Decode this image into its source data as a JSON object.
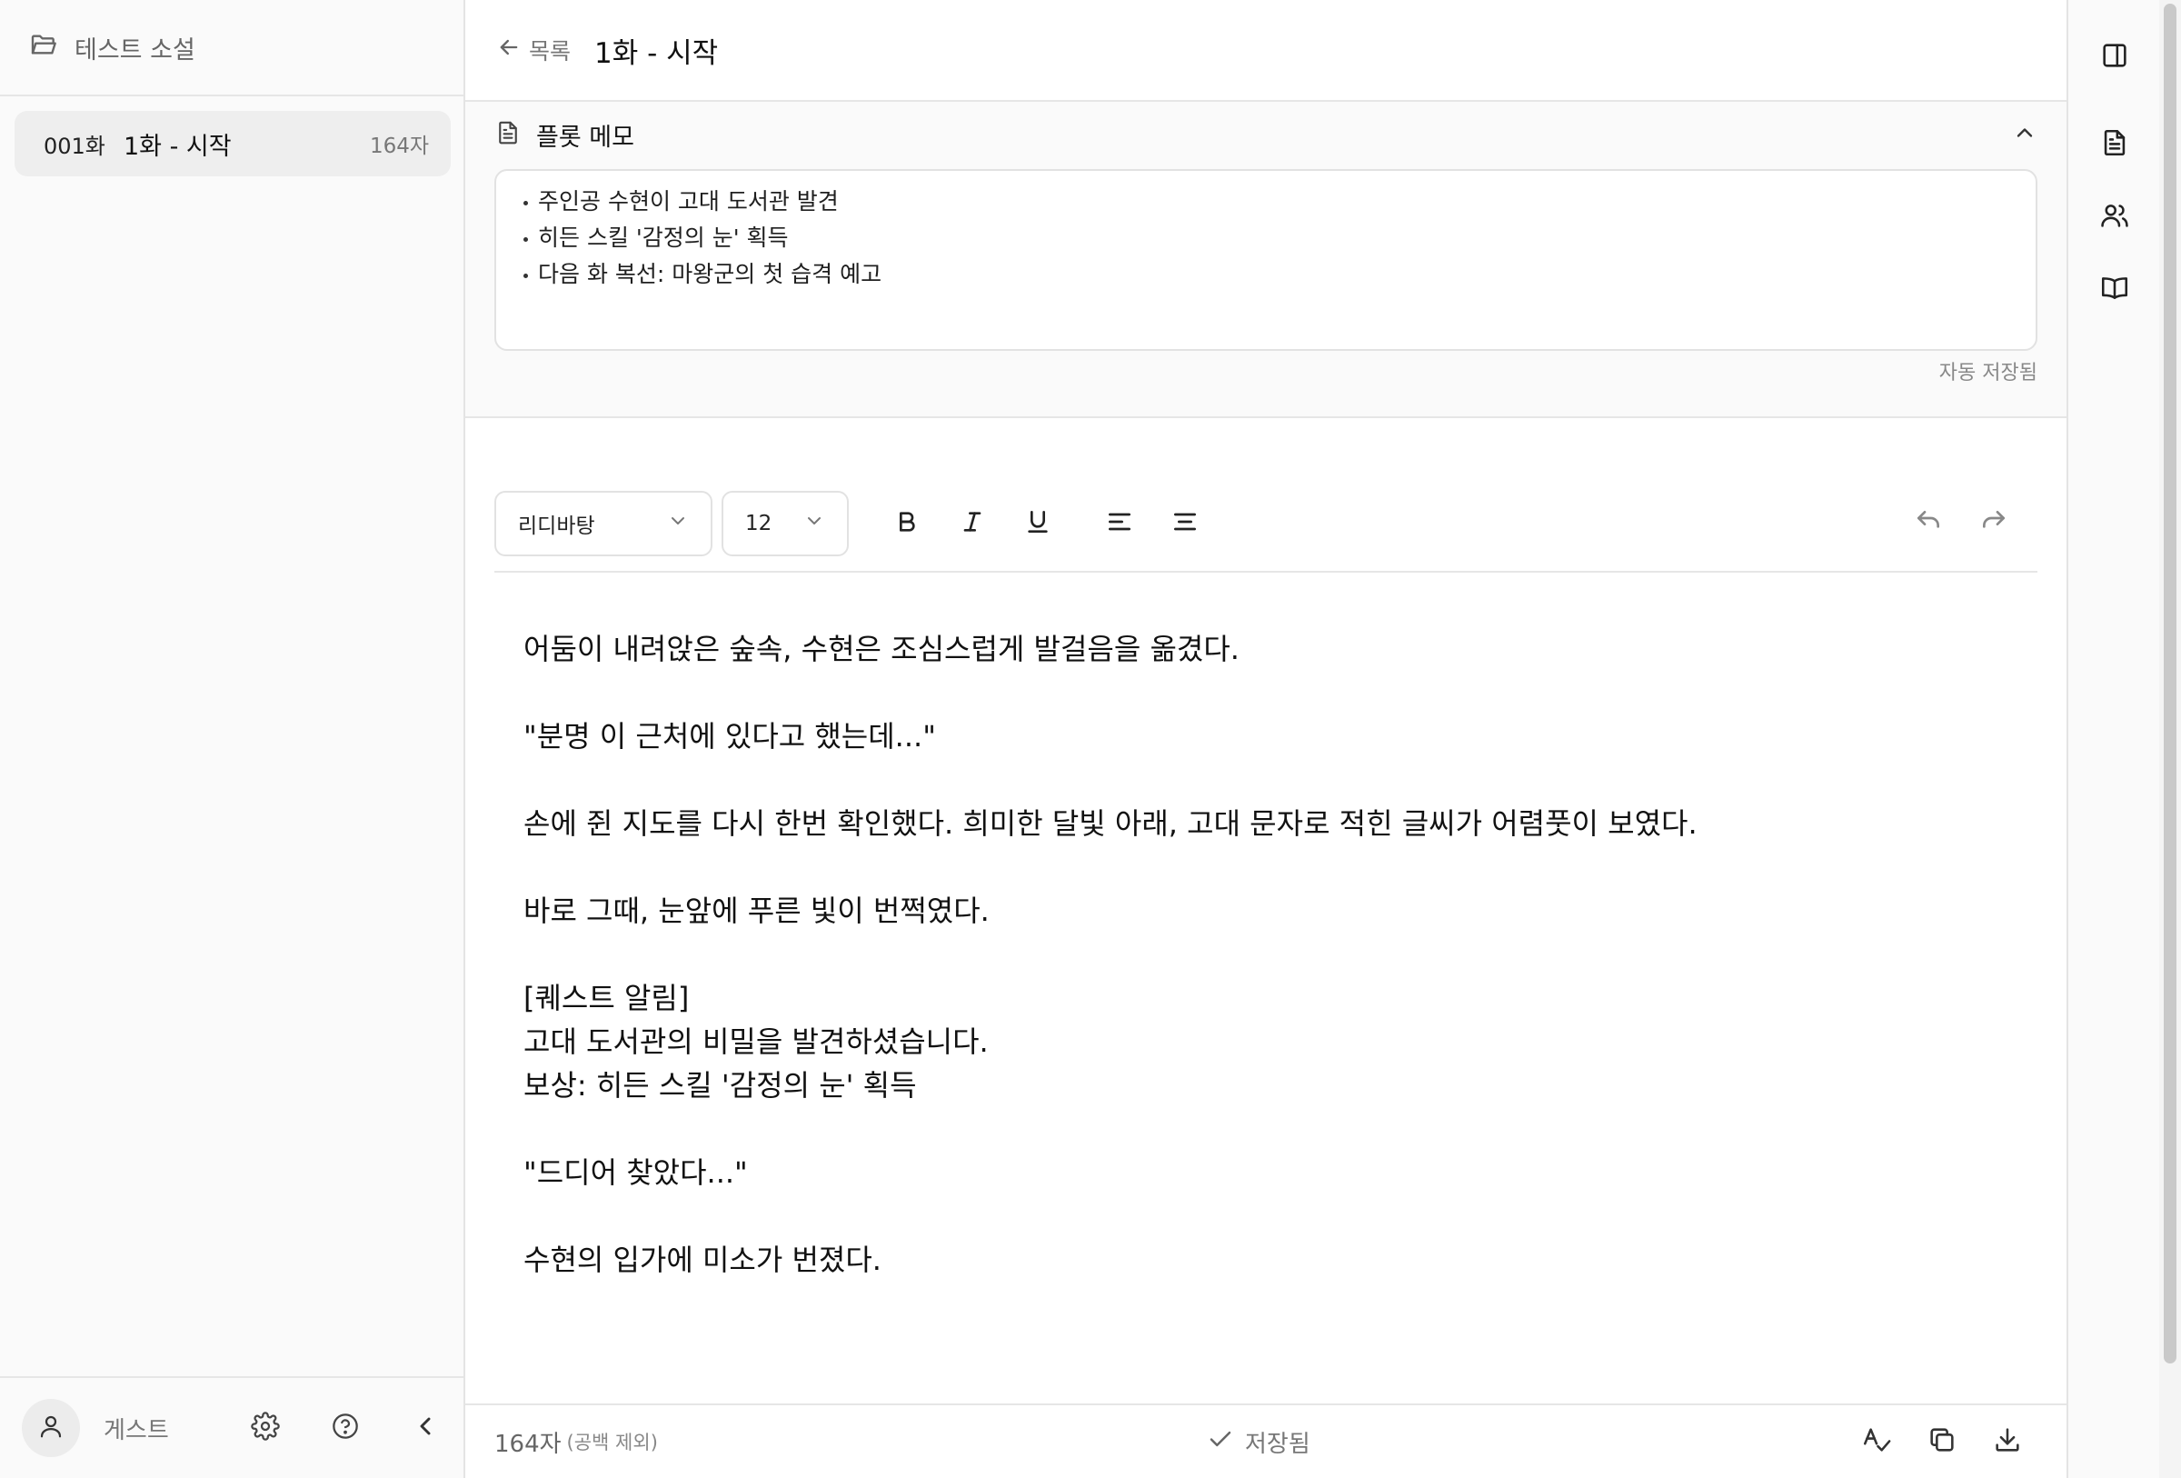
{
  "sidebar": {
    "project_title": "테스트 소설",
    "episodes": [
      {
        "number": "001화",
        "title": "1화 - 시작",
        "count": "164자"
      }
    ],
    "user_name": "게스트"
  },
  "header": {
    "back_label": "목록",
    "episode_title": "1화 - 시작"
  },
  "plot_memo": {
    "title": "플롯 메모",
    "items": [
      "주인공 수현이 고대 도서관 발견",
      "히든 스킬 '감정의 눈' 획득",
      "다음 화 복선: 마왕군의 첫 습격 예고"
    ],
    "autosave_label": "자동 저장됨"
  },
  "toolbar": {
    "font_value": "리디바탕",
    "size_value": "12"
  },
  "editor": {
    "paragraphs": [
      "어둠이 내려앉은 숲속, 수현은 조심스럽게 발걸음을 옮겼다.",
      "",
      "\"분명 이 근처에 있다고 했는데...\"",
      "",
      "손에 쥔 지도를 다시 한번 확인했다. 희미한 달빛 아래, 고대 문자로 적힌 글씨가 어렴풋이 보였다.",
      "",
      "바로 그때, 눈앞에 푸른 빛이 번쩍였다.",
      "",
      "[퀘스트 알림]",
      "고대 도서관의 비밀을 발견하셨습니다.",
      "보상: 히든 스킬 '감정의 눈' 획득",
      "",
      "\"드디어 찾았다...\"",
      "",
      "수현의 입가에 미소가 번졌다."
    ]
  },
  "status": {
    "char_count": "164자",
    "char_note": "(공백 제외)",
    "save_state": "저장됨"
  },
  "colors": {
    "sidebar_bg": "#fafafa",
    "selected_item_bg": "#eeeeee",
    "border": "#e4e4e4",
    "muted_text": "#777777"
  }
}
